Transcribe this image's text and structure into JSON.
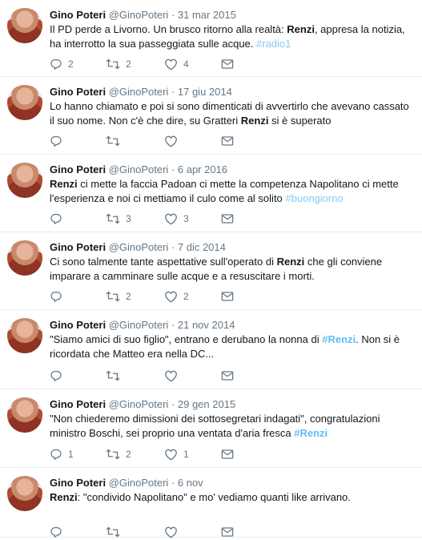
{
  "tweets": [
    {
      "name": "Gino Poteri",
      "handle": "@GinoPoteri",
      "date": "31 mar 2015",
      "segments": [
        {
          "t": "Il PD perde a Livorno. Un brusco ritorno alla realtà: "
        },
        {
          "t": "Renzi",
          "b": true
        },
        {
          "t": ", appresa la notizia, ha interrotto la sua passeggiata sulle acque. "
        },
        {
          "t": "#radio1",
          "h": true
        }
      ],
      "replies": "2",
      "retweets": "2",
      "likes": "4"
    },
    {
      "name": "Gino Poteri",
      "handle": "@GinoPoteri",
      "date": "17 giu 2014",
      "segments": [
        {
          "t": "Lo hanno chiamato e poi si sono dimenticati di avvertirlo che avevano cassato il suo nome. Non c'è che dire, su Gratteri "
        },
        {
          "t": "Renzi",
          "b": true
        },
        {
          "t": " si è superato"
        }
      ],
      "replies": "",
      "retweets": "",
      "likes": ""
    },
    {
      "name": "Gino Poteri",
      "handle": "@GinoPoteri",
      "date": "6 apr 2016",
      "segments": [
        {
          "t": "Renzi",
          "b": true
        },
        {
          "t": " ci mette la faccia Padoan ci mette la competenza Napolitano ci mette l'esperienza e noi ci mettiamo il culo come al solito "
        },
        {
          "t": "#buongiorno",
          "h": true
        }
      ],
      "replies": "",
      "retweets": "3",
      "likes": "3"
    },
    {
      "name": "Gino Poteri",
      "handle": "@GinoPoteri",
      "date": "7 dic 2014",
      "segments": [
        {
          "t": "Ci sono talmente tante aspettative sull'operato di "
        },
        {
          "t": "Renzi",
          "b": true
        },
        {
          "t": " che gli conviene imparare a camminare sulle acque e a resuscitare i morti."
        }
      ],
      "replies": "",
      "retweets": "2",
      "likes": "2"
    },
    {
      "name": "Gino Poteri",
      "handle": "@GinoPoteri",
      "date": "21 nov 2014",
      "segments": [
        {
          "t": "\"Siamo amici di suo figlio\", entrano e derubano la nonna di "
        },
        {
          "t": "#Renzi",
          "h": true,
          "hb": true
        },
        {
          "t": ". Non si è ricordata che Matteo era nella DC..."
        }
      ],
      "replies": "",
      "retweets": "",
      "likes": ""
    },
    {
      "name": "Gino Poteri",
      "handle": "@GinoPoteri",
      "date": "29 gen 2015",
      "segments": [
        {
          "t": "\"Non chiederemo dimissioni dei sottosegretari indagati\", congratulazioni ministro Boschi, sei proprio una ventata d'aria fresca "
        },
        {
          "t": "#Renzi",
          "h": true,
          "hb": true
        }
      ],
      "replies": "1",
      "retweets": "2",
      "likes": "1"
    },
    {
      "name": "Gino Poteri",
      "handle": "@GinoPoteri",
      "date": "6 nov",
      "segments": [
        {
          "t": "Renzi",
          "b": true
        },
        {
          "t": ": \"condivido Napolitano\" e mo' vediamo quanti like arrivano."
        }
      ],
      "replies": "",
      "retweets": "",
      "likes": ""
    }
  ],
  "icons": {
    "reply": "reply-icon",
    "retweet": "retweet-icon",
    "like": "heart-icon",
    "message": "envelope-icon"
  },
  "colors": {
    "text": "#14171a",
    "muted": "#657786",
    "hashtag": "#1da1f2",
    "divider": "#e6ecf0"
  }
}
